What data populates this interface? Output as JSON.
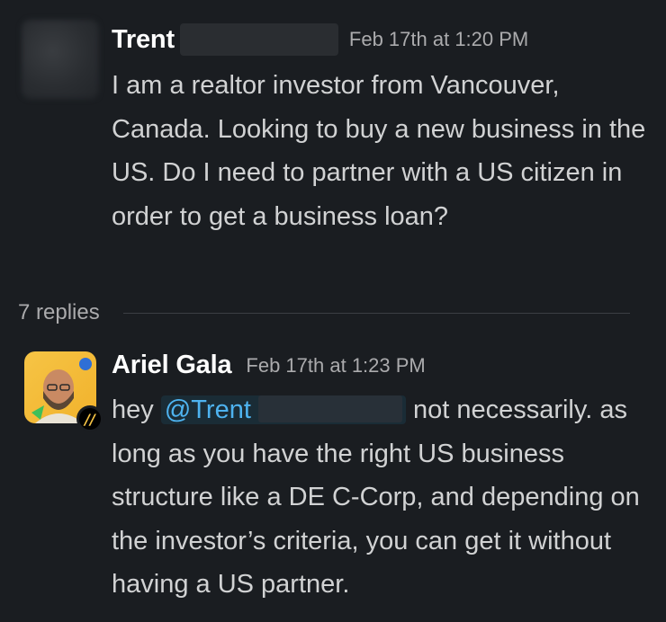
{
  "message1": {
    "author": "Trent",
    "timestamp": "Feb 17th at 1:20 PM",
    "body": "I am a realtor investor from Vancouver, Canada. Looking to buy a new business in the US. Do I need to partner with a US citizen in order to get a business loan?"
  },
  "thread": {
    "replies_label": "7 replies"
  },
  "message2": {
    "author": "Ariel Gala",
    "timestamp": "Feb 17th at 1:23 PM",
    "prefix": "hey ",
    "mention": "@Trent",
    "suffix": " not necessarily. as long as you have the right US business structure like a DE C-Corp, and depending on the investor’s criteria, you can get it without having a US partner.",
    "status_badge": "//"
  },
  "colors": {
    "background": "#1a1d21",
    "text": "#d1d2d3",
    "timestamp": "#ababad",
    "mention": "#4eb3f0",
    "avatar_accent": "#f6c445"
  }
}
